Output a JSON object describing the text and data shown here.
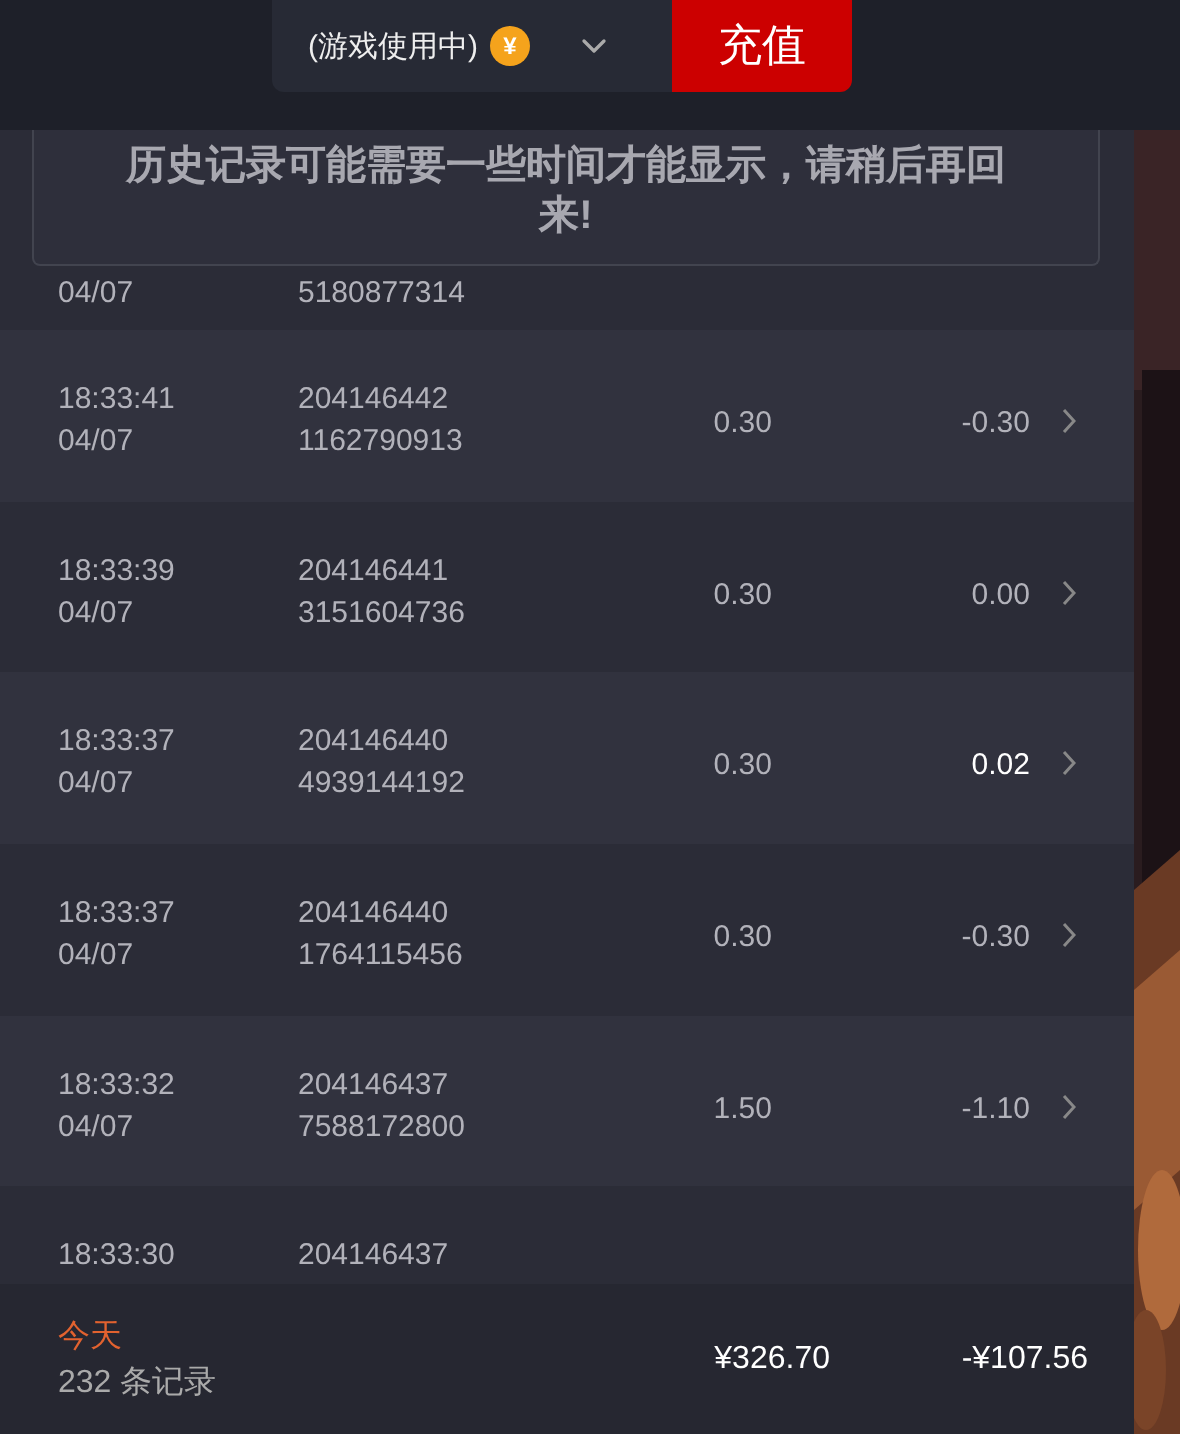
{
  "header": {
    "account": {
      "label": "(游戏使用中)",
      "coin_symbol": "¥"
    },
    "recharge_button": "充值"
  },
  "notice": "历史记录可能需要一些时间才能显示，请稍后再回来!",
  "rows": [
    {
      "date": "04/07",
      "serial": "5180877314"
    },
    {
      "time": "18:33:41",
      "date": "04/07",
      "order": "204146442",
      "serial": "1162790913",
      "amount": "0.30",
      "change": "-0.30",
      "highlight": false
    },
    {
      "time": "18:33:39",
      "date": "04/07",
      "order": "204146441",
      "serial": "3151604736",
      "amount": "0.30",
      "change": "0.00",
      "highlight": false
    },
    {
      "time": "18:33:37",
      "date": "04/07",
      "order": "204146440",
      "serial": "4939144192",
      "amount": "0.30",
      "change": "0.02",
      "highlight": true
    },
    {
      "time": "18:33:37",
      "date": "04/07",
      "order": "204146440",
      "serial": "1764115456",
      "amount": "0.30",
      "change": "-0.30",
      "highlight": false
    },
    {
      "time": "18:33:32",
      "date": "04/07",
      "order": "204146437",
      "serial": "7588172800",
      "amount": "1.50",
      "change": "-1.10",
      "highlight": false
    },
    {
      "time": "18:33:30",
      "order": "204146437"
    }
  ],
  "footer": {
    "period": "今天",
    "count": "232 条记录",
    "amount_total": "¥326.70",
    "change_total": "-¥107.56"
  }
}
